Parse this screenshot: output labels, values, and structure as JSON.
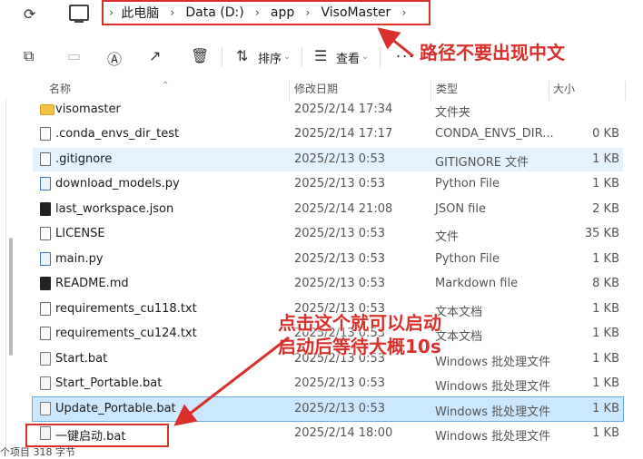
{
  "address_bar": {
    "refresh_icon": "refresh-icon",
    "pc_icon": "computer-icon",
    "crumbs": [
      "此电脑",
      "Data (D:)",
      "app",
      "VisoMaster"
    ]
  },
  "toolbar": {
    "sort_label": "排序",
    "view_label": "查看",
    "more_label": "..."
  },
  "annotations": {
    "path_note": "路径不要出现中文",
    "click_note_line1": "点击这个就可以启动",
    "click_note_line2": "启动后等待大概10s",
    "color": "#d9302c"
  },
  "columns": {
    "name": "名称",
    "modified": "修改日期",
    "type": "类型",
    "size": "大小"
  },
  "files": [
    {
      "name": "visomaster",
      "date": "2025/2/14 17:34",
      "type": "文件夹",
      "size": "",
      "icon": "folder"
    },
    {
      "name": ".conda_envs_dir_test",
      "date": "2025/2/14 17:17",
      "type": "CONDA_ENVS_DIR...",
      "size": "0 KB",
      "icon": "file"
    },
    {
      "name": ".gitignore",
      "date": "2025/2/13 0:53",
      "type": "GITIGNORE 文件",
      "size": "1 KB",
      "icon": "file"
    },
    {
      "name": "download_models.py",
      "date": "2025/2/13 0:53",
      "type": "Python File",
      "size": "1 KB",
      "icon": "py"
    },
    {
      "name": "last_workspace.json",
      "date": "2025/2/14 21:08",
      "type": "JSON file",
      "size": "2 KB",
      "icon": "dark"
    },
    {
      "name": "LICENSE",
      "date": "2025/2/13 0:53",
      "type": "文件",
      "size": "35 KB",
      "icon": "file"
    },
    {
      "name": "main.py",
      "date": "2025/2/13 0:53",
      "type": "Python File",
      "size": "1 KB",
      "icon": "py"
    },
    {
      "name": "README.md",
      "date": "2025/2/13 0:53",
      "type": "Markdown file",
      "size": "8 KB",
      "icon": "dark"
    },
    {
      "name": "requirements_cu118.txt",
      "date": "2025/2/13 0:53",
      "type": "文本文档",
      "size": "1 KB",
      "icon": "file"
    },
    {
      "name": "requirements_cu124.txt",
      "date": "2025/2/13 0:53",
      "type": "文本文档",
      "size": "1 KB",
      "icon": "file"
    },
    {
      "name": "Start.bat",
      "date": "2025/2/13 0:53",
      "type": "Windows 批处理文件",
      "size": "1 KB",
      "icon": "bat"
    },
    {
      "name": "Start_Portable.bat",
      "date": "2025/2/13 0:53",
      "type": "Windows 批处理文件",
      "size": "1 KB",
      "icon": "bat"
    },
    {
      "name": "Update_Portable.bat",
      "date": "2025/2/13 0:53",
      "type": "Windows 批处理文件",
      "size": "1 KB",
      "icon": "bat"
    },
    {
      "name": "一键启动.bat",
      "date": "2025/2/14 18:00",
      "type": "Windows 批处理文件",
      "size": "1 KB",
      "icon": "bat"
    }
  ],
  "status_bar": {
    "text": "个项目 318 字节"
  }
}
